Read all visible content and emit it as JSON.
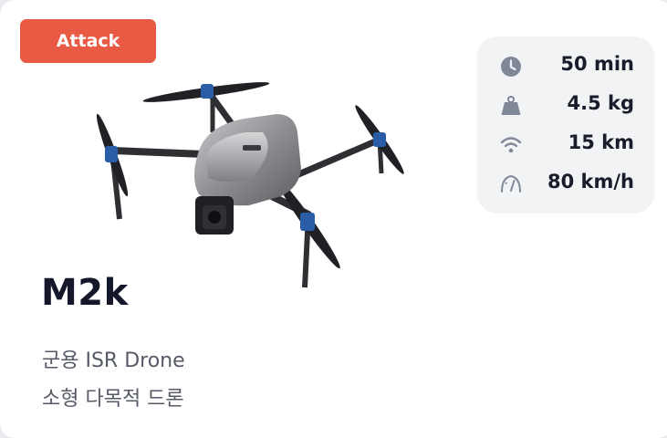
{
  "card": {
    "badge": "Attack",
    "name": "M2k",
    "description": [
      "군용 ISR Drone",
      "소형 다목적 드론"
    ],
    "colors": {
      "badge": "#e85a43",
      "spec_panel": "#f1f3f5",
      "icon": "#7f8799",
      "title": "#15172a",
      "desc": "#555a66"
    }
  },
  "specs": [
    {
      "icon": "clock-icon",
      "value": "50 min"
    },
    {
      "icon": "weight-icon",
      "value": "4.5 kg"
    },
    {
      "icon": "signal-icon",
      "value": "15 km"
    },
    {
      "icon": "speedometer-icon",
      "value": "80 km/h"
    }
  ],
  "image": {
    "icon": "quadcopter-drone-image"
  }
}
